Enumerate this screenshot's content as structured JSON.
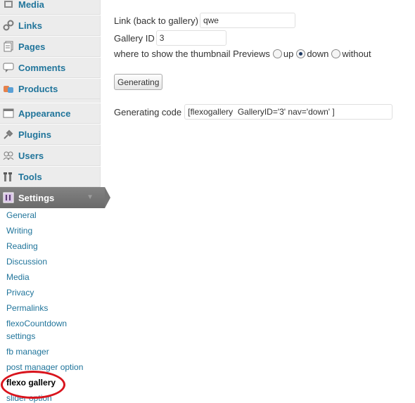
{
  "sidebar": {
    "menu": [
      {
        "label": "Media",
        "icon": "media-icon"
      },
      {
        "label": "Links",
        "icon": "links-icon"
      },
      {
        "label": "Pages",
        "icon": "pages-icon"
      },
      {
        "label": "Comments",
        "icon": "comments-icon"
      },
      {
        "label": "Products",
        "icon": "products-icon"
      },
      {
        "label": "Appearance",
        "icon": "appearance-icon"
      },
      {
        "label": "Plugins",
        "icon": "plugins-icon"
      },
      {
        "label": "Users",
        "icon": "users-icon"
      },
      {
        "label": "Tools",
        "icon": "tools-icon"
      }
    ],
    "settings_label": "Settings",
    "submenu": [
      "General",
      "Writing",
      "Reading",
      "Discussion",
      "Media",
      "Privacy",
      "Permalinks",
      "flexoCountdown",
      "settings",
      "fb manager",
      "post manager option",
      "flexo gallery",
      "slider option"
    ],
    "current_submenu": "flexo gallery",
    "highlight_color": "#d9141d"
  },
  "form": {
    "link_label": "Link (back to gallery)",
    "link_value": "qwe",
    "gallery_id_label": "Gallery ID",
    "gallery_id_value": "3",
    "preview_label": "where to show the thumbnail Previews",
    "preview_options": [
      "up",
      "down",
      "without"
    ],
    "preview_selected": "down",
    "generate_button": "Generating",
    "code_label": "Generating code",
    "code_value": "[flexogallery  GalleryID='3' nav='down' ]"
  },
  "colors": {
    "link": "#21759b",
    "sidebar_bg": "#ececec",
    "settings_bg": "#6a6a6a"
  }
}
